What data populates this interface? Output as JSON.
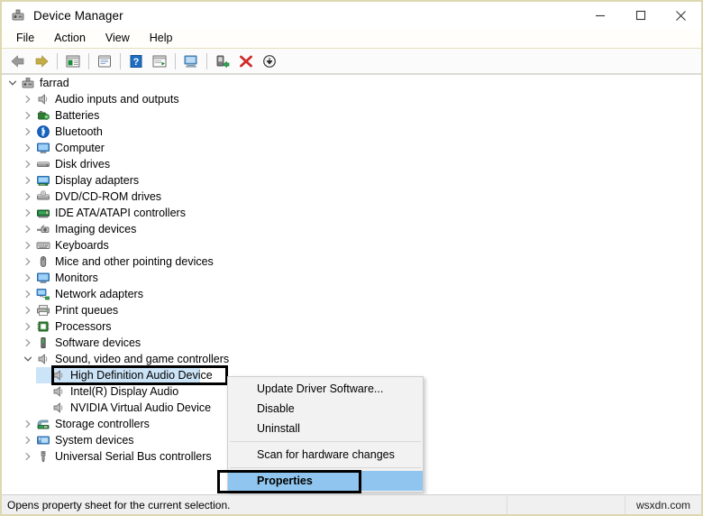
{
  "window": {
    "title": "Device Manager",
    "title_icon": "device-manager-icon",
    "minimize_label": "–",
    "maximize_label": "□",
    "close_label": "✕"
  },
  "menubar": {
    "items": [
      {
        "label": "File"
      },
      {
        "label": "Action"
      },
      {
        "label": "View"
      },
      {
        "label": "Help"
      }
    ]
  },
  "toolbar": {
    "buttons": [
      {
        "name": "back-icon",
        "tooltip": "Back"
      },
      {
        "name": "forward-icon",
        "tooltip": "Forward"
      },
      {
        "name": "show-hide-console-tree-icon",
        "tooltip": "Show/Hide Console Tree"
      },
      {
        "name": "properties-icon",
        "tooltip": "Properties"
      },
      {
        "name": "help-icon",
        "tooltip": "Help"
      },
      {
        "name": "scan-hardware-icon",
        "tooltip": "Scan for hardware changes"
      },
      {
        "name": "update-driver-icon",
        "tooltip": "Update Driver Software"
      },
      {
        "name": "enable-device-icon",
        "tooltip": "Enable device"
      },
      {
        "name": "uninstall-device-icon",
        "tooltip": "Uninstall device"
      },
      {
        "name": "disable-device-icon",
        "tooltip": "Disable device"
      }
    ]
  },
  "tree": {
    "root": {
      "label": "farrad",
      "icon": "computer-root-icon",
      "expanded": true
    },
    "items": [
      {
        "label": "Audio inputs and outputs",
        "icon": "speaker-icon",
        "expandable": true,
        "expanded": false,
        "level": 1
      },
      {
        "label": "Batteries",
        "icon": "battery-icon",
        "expandable": true,
        "expanded": false,
        "level": 1
      },
      {
        "label": "Bluetooth",
        "icon": "bluetooth-icon",
        "expandable": true,
        "expanded": false,
        "level": 1
      },
      {
        "label": "Computer",
        "icon": "monitor-icon",
        "expandable": true,
        "expanded": false,
        "level": 1
      },
      {
        "label": "Disk drives",
        "icon": "disk-drive-icon",
        "expandable": true,
        "expanded": false,
        "level": 1
      },
      {
        "label": "Display adapters",
        "icon": "display-adapter-icon",
        "expandable": true,
        "expanded": false,
        "level": 1
      },
      {
        "label": "DVD/CD-ROM drives",
        "icon": "dvd-drive-icon",
        "expandable": true,
        "expanded": false,
        "level": 1
      },
      {
        "label": "IDE ATA/ATAPI controllers",
        "icon": "ide-controller-icon",
        "expandable": true,
        "expanded": false,
        "level": 1
      },
      {
        "label": "Imaging devices",
        "icon": "camera-icon",
        "expandable": true,
        "expanded": false,
        "level": 1
      },
      {
        "label": "Keyboards",
        "icon": "keyboard-icon",
        "expandable": true,
        "expanded": false,
        "level": 1
      },
      {
        "label": "Mice and other pointing devices",
        "icon": "mouse-icon",
        "expandable": true,
        "expanded": false,
        "level": 1
      },
      {
        "label": "Monitors",
        "icon": "monitor-icon",
        "expandable": true,
        "expanded": false,
        "level": 1
      },
      {
        "label": "Network adapters",
        "icon": "network-adapter-icon",
        "expandable": true,
        "expanded": false,
        "level": 1
      },
      {
        "label": "Print queues",
        "icon": "printer-icon",
        "expandable": true,
        "expanded": false,
        "level": 1
      },
      {
        "label": "Processors",
        "icon": "processor-icon",
        "expandable": true,
        "expanded": false,
        "level": 1
      },
      {
        "label": "Software devices",
        "icon": "software-device-icon",
        "expandable": true,
        "expanded": false,
        "level": 1
      },
      {
        "label": "Sound, video and game controllers",
        "icon": "speaker-icon",
        "expandable": true,
        "expanded": true,
        "level": 1
      },
      {
        "label": "High Definition Audio Device",
        "icon": "speaker-icon",
        "expandable": false,
        "expanded": false,
        "level": 2,
        "selected": true
      },
      {
        "label": "Intel(R) Display Audio",
        "icon": "speaker-icon",
        "expandable": false,
        "expanded": false,
        "level": 2
      },
      {
        "label": "NVIDIA Virtual Audio Device",
        "icon": "speaker-icon",
        "expandable": false,
        "expanded": false,
        "level": 2
      },
      {
        "label": "Storage controllers",
        "icon": "storage-controller-icon",
        "expandable": true,
        "expanded": false,
        "level": 1
      },
      {
        "label": "System devices",
        "icon": "system-device-icon",
        "expandable": true,
        "expanded": false,
        "level": 1
      },
      {
        "label": "Universal Serial Bus controllers",
        "icon": "usb-icon",
        "expandable": true,
        "expanded": false,
        "level": 1
      }
    ]
  },
  "context_menu": {
    "items": [
      {
        "label": "Update Driver Software...",
        "highlighted": false,
        "bold": false,
        "separator_after": false
      },
      {
        "label": "Disable",
        "highlighted": false,
        "bold": false,
        "separator_after": false
      },
      {
        "label": "Uninstall",
        "highlighted": false,
        "bold": false,
        "separator_after": true
      },
      {
        "label": "Scan for hardware changes",
        "highlighted": false,
        "bold": false,
        "separator_after": true
      },
      {
        "label": "Properties",
        "highlighted": true,
        "bold": true,
        "separator_after": false
      }
    ]
  },
  "statusbar": {
    "message": "Opens property sheet for the current selection.",
    "watermark": "wsxdn.com"
  },
  "colors": {
    "selection_blue": "#cce4f7",
    "menu_highlight_blue": "#8fc5ee",
    "annotation_black": "#000000",
    "window_border": "#ded8b0"
  }
}
